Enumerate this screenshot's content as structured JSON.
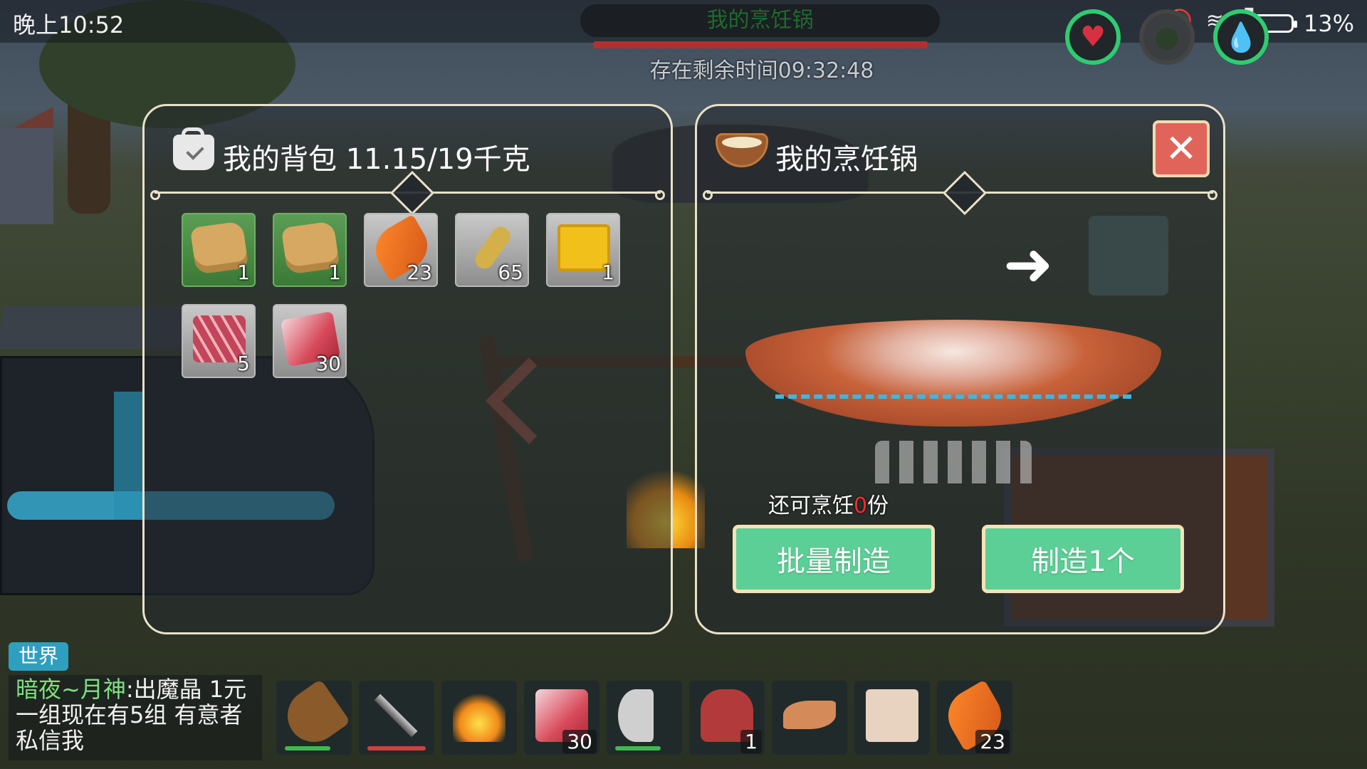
{
  "status_bar": {
    "time": "晚上10:52",
    "battery_percent": "13%",
    "battery_level": 0.13
  },
  "top": {
    "title": "我的烹饪锅",
    "remaining_time": "存在剩余时间09:32:48"
  },
  "backpack_panel": {
    "title": "我的背包  11.15/19千克",
    "items": [
      {
        "name": "seed-bag-wheat",
        "count": "1",
        "style": "green"
      },
      {
        "name": "seed-bag-carrot",
        "count": "1",
        "style": "green"
      },
      {
        "name": "carrot",
        "count": "23",
        "style": "grey"
      },
      {
        "name": "wheat",
        "count": "65",
        "style": "grey"
      },
      {
        "name": "honeycomb",
        "count": "1",
        "style": "grey"
      },
      {
        "name": "ribs",
        "count": "5",
        "style": "grey"
      },
      {
        "name": "raw-meat",
        "count": "30",
        "style": "grey"
      }
    ]
  },
  "cooking_panel": {
    "title": "我的烹饪锅",
    "close_icon": "close-icon",
    "remaining_prefix": "还可烹饪",
    "remaining_count": "0",
    "remaining_suffix": "份",
    "batch_button": "批量制造",
    "make_one_button": "制造1个"
  },
  "chat": {
    "tab": "世界",
    "sender": "暗夜~月神",
    "separator": ":",
    "message": "出魔晶 1元一组现在有5组 有意者私信我"
  },
  "hotbar": [
    {
      "name": "club",
      "count": "",
      "durability": "green"
    },
    {
      "name": "sword",
      "count": "",
      "durability": "red"
    },
    {
      "name": "campfire",
      "count": "",
      "durability": ""
    },
    {
      "name": "raw-meat",
      "count": "30",
      "durability": ""
    },
    {
      "name": "axe",
      "count": "",
      "durability": "green"
    },
    {
      "name": "armor",
      "count": "1",
      "durability": ""
    },
    {
      "name": "boots",
      "count": "",
      "durability": ""
    },
    {
      "name": "shirt",
      "count": "",
      "durability": ""
    },
    {
      "name": "carrot",
      "count": "23",
      "durability": ""
    }
  ],
  "colors": {
    "panel_border": "#e9e1c8",
    "button_green": "#5ccf96",
    "close_red": "#e0645a",
    "gauge_green": "#2ecc71",
    "alert_red": "#ff2a2a"
  }
}
